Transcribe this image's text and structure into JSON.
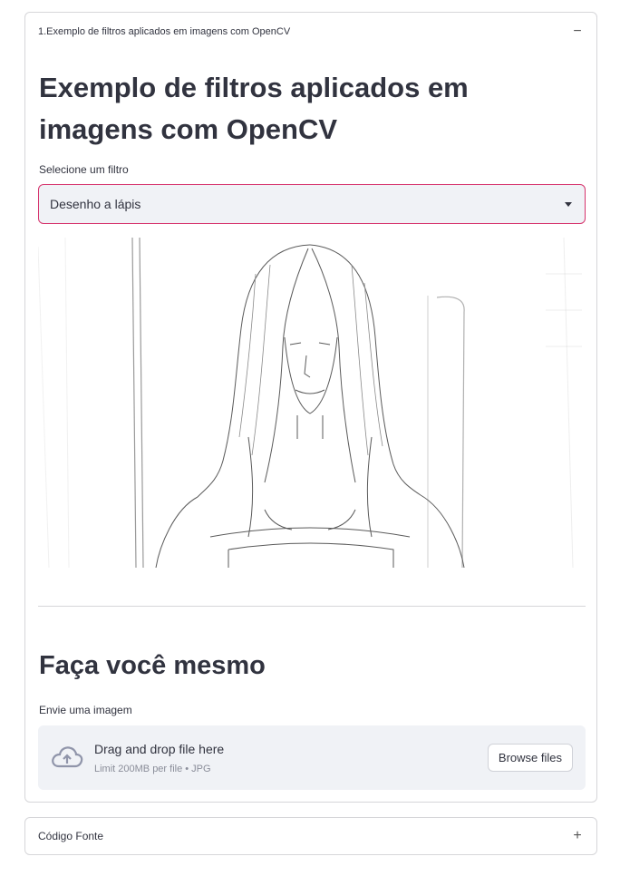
{
  "expander_main": {
    "header": "1.Exemplo de filtros aplicados em imagens com OpenCV",
    "toggle_icon": "minus-icon",
    "title": "Exemplo de filtros aplicados em imagens com OpenCV",
    "filter_label": "Selecione um filtro",
    "filter_selected": "Desenho a lápis",
    "caret_icon": "chevron-down-icon",
    "image_filter": "pencil-sketch",
    "section_title": "Faça você mesmo",
    "upload_label": "Envie uma imagem",
    "dropzone": {
      "icon": "cloud-upload-icon",
      "main_text": "Drag and drop file here",
      "sub_text": "Limit 200MB per file • JPG",
      "button_label": "Browse files"
    }
  },
  "expander_source": {
    "header": "Código Fonte",
    "toggle_icon": "plus-icon"
  },
  "colors": {
    "text": "#31333F",
    "focus_border": "#d6336c",
    "input_bg": "#f0f2f6",
    "border": "#d6d6d9"
  }
}
